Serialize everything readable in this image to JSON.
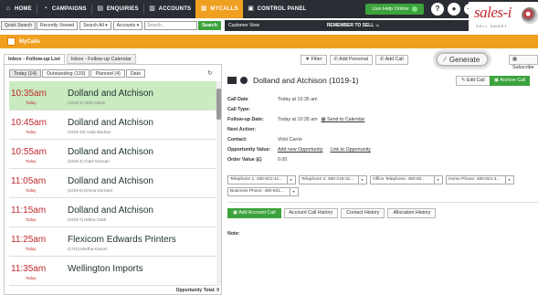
{
  "nav": {
    "home": "HOME",
    "campaigns": "CAMPAIGNS",
    "enquiries": "ENQUIRIES",
    "accounts": "ACCOUNTS",
    "mycalls": "MYCALLS",
    "control_panel": "CONTROL PANEL",
    "live_help": "Live Help Online",
    "help_glyph": "?",
    "user_glyph": "●",
    "add_glyph": "+"
  },
  "logo": {
    "brand": "sales-i",
    "tagline": "SELL SMART"
  },
  "searchbar": {
    "quick_search": "Quick Search",
    "recently_viewed": "Recently Viewed",
    "search_scope": "Search All",
    "search_type": "Accounts",
    "placeholder": "Search...",
    "search_button": "Search",
    "customer_view": "Customer View",
    "remember": "REMEMBER TO SELL ☺"
  },
  "page_header": {
    "title": "MyCalls"
  },
  "left": {
    "tabs": [
      "Inbox - Follow-up List",
      "Inbox - Follow-up Calendar"
    ],
    "subtabs": [
      "Today (14)",
      "Outstanding (133)",
      "Planned (4)",
      "Date"
    ],
    "calls": [
      {
        "time": "10:35am",
        "day": "Today",
        "name": "Dolland and Atchison",
        "sub": "(1019-1)   Vicki Carrie"
      },
      {
        "time": "10:45am",
        "day": "Today",
        "name": "Dolland and Atchison",
        "sub": "(1019-10)   Andy Bachan"
      },
      {
        "time": "10:55am",
        "day": "Today",
        "name": "Dolland and Atchison",
        "sub": "(1019-4)   Clare Duncan"
      },
      {
        "time": "11:05am",
        "day": "Today",
        "name": "Dolland and Atchison",
        "sub": "(1019-6)   Emma Dorrand"
      },
      {
        "time": "11:15am",
        "day": "Today",
        "name": "Dolland and Atchison",
        "sub": "(1019-7)   Debra Clark"
      },
      {
        "time": "11:25am",
        "day": "Today",
        "name": "Flexicom Edwards Printers",
        "sub": "(1710)   Martha Kinnon"
      },
      {
        "time": "11:35am",
        "day": "Today",
        "name": "Wellington Imports",
        "sub": ""
      }
    ],
    "opp_total": "Opportunity Total: 0"
  },
  "toolbar": {
    "filter": "Filter",
    "add_personal": "Add Personal",
    "add_call": "Add Call",
    "generate": "Generate",
    "subscribe": "Subscribe"
  },
  "detail": {
    "title": "Dolland and Atchison (1019-1)",
    "edit_call": "Edit Call",
    "archive_call": "Archive Call",
    "fields": [
      {
        "k": "Call Date",
        "v": "Today at 10:35 am",
        "link": ""
      },
      {
        "k": "Call Type:",
        "v": "",
        "link": ""
      },
      {
        "k": "Follow-up Date:",
        "v": "Today at 10:35 am",
        "link": "Send to Calendar"
      },
      {
        "k": "Next Action:",
        "v": "",
        "link": ""
      },
      {
        "k": "Contact:",
        "v": "Vicki Carrie",
        "link": ""
      },
      {
        "k": "Opportunity Value:",
        "v": "Add new Opportunity",
        "link": "Link to Opportunity"
      },
      {
        "k": "Order Value (£)",
        "v": "0.00",
        "link": ""
      }
    ],
    "phones": [
      "Telephone 1: 480-821-41...",
      "Telephone 2: 480-219-31...",
      "Office Telephone: 480-82...",
      "Home Phone: 480-821-4...",
      "Business Phone: 480-821..."
    ],
    "actions": [
      "Add Account Call",
      "Account Call History",
      "Contact History",
      "Allocation History"
    ],
    "note_label": "Note:"
  }
}
